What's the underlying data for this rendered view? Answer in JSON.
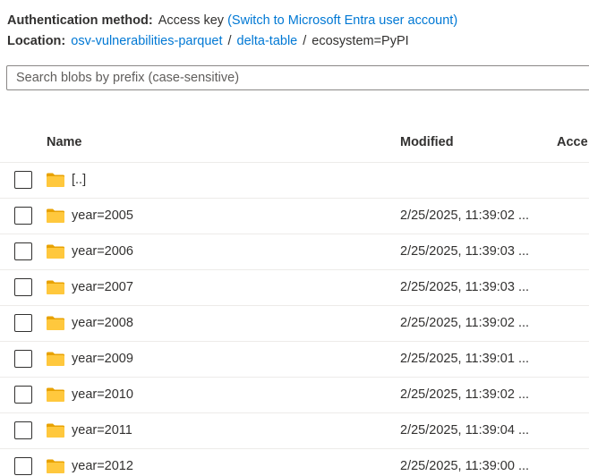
{
  "auth": {
    "label": "Authentication method:",
    "value": "Access key",
    "switch_link": "(Switch to Microsoft Entra user account)"
  },
  "location": {
    "label": "Location:",
    "crumbs": [
      "osv-vulnerabilities-parquet",
      "delta-table"
    ],
    "current": "ecosystem=PyPI",
    "separator": "/"
  },
  "search": {
    "placeholder": "Search blobs by prefix (case-sensitive)",
    "value": ""
  },
  "table": {
    "columns": {
      "name": "Name",
      "modified": "Modified",
      "access": "Acce"
    },
    "rows": [
      {
        "name": "[..]",
        "modified": ""
      },
      {
        "name": "year=2005",
        "modified": "2/25/2025, 11:39:02 ..."
      },
      {
        "name": "year=2006",
        "modified": "2/25/2025, 11:39:03 ..."
      },
      {
        "name": "year=2007",
        "modified": "2/25/2025, 11:39:03 ..."
      },
      {
        "name": "year=2008",
        "modified": "2/25/2025, 11:39:02 ..."
      },
      {
        "name": "year=2009",
        "modified": "2/25/2025, 11:39:01 ..."
      },
      {
        "name": "year=2010",
        "modified": "2/25/2025, 11:39:02 ..."
      },
      {
        "name": "year=2011",
        "modified": "2/25/2025, 11:39:04 ..."
      },
      {
        "name": "year=2012",
        "modified": "2/25/2025, 11:39:00 ..."
      }
    ]
  },
  "colors": {
    "link": "#0078d4",
    "folder": "#ffb900",
    "divider": "#edebe9"
  },
  "icons": {
    "folder": "folder-icon",
    "checkbox": "checkbox"
  }
}
